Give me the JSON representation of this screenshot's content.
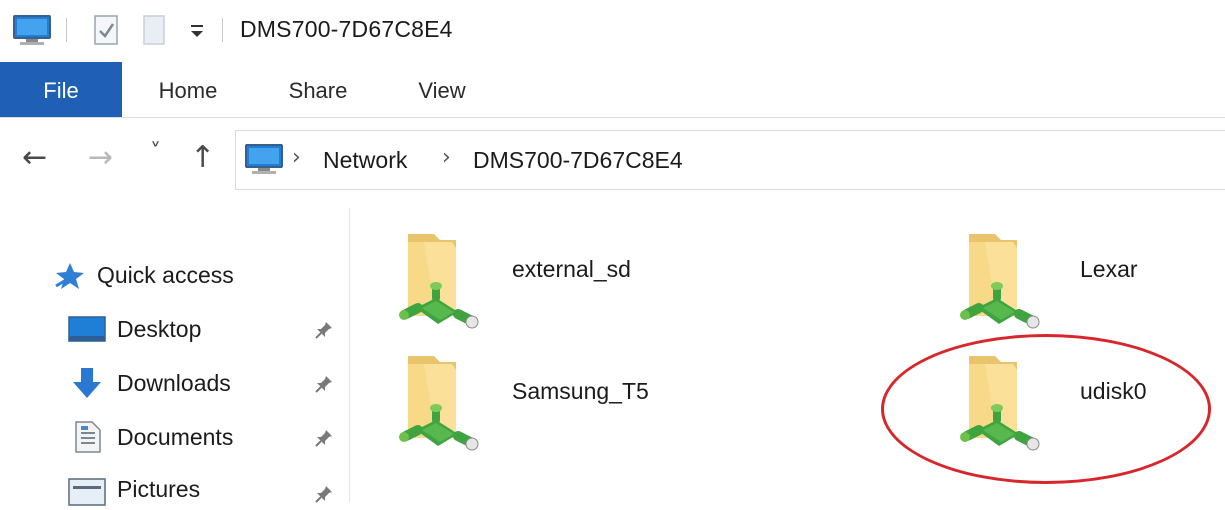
{
  "window": {
    "title": "DMS700-7D67C8E4",
    "qat_icons": [
      "computer-icon",
      "properties-icon",
      "new-folder-icon",
      "customize-qat-icon"
    ]
  },
  "ribbon": {
    "tabs": [
      {
        "label": "File",
        "active": true
      },
      {
        "label": "Home"
      },
      {
        "label": "Share"
      },
      {
        "label": "View"
      }
    ],
    "accent": "#1f5fb5"
  },
  "address_bar": {
    "crumbs": [
      "Network",
      "DMS700-7D67C8E4"
    ],
    "root_icon": "computer-icon",
    "separator": "›"
  },
  "nav_buttons": {
    "back": "←",
    "forward": "→",
    "recent": "˅",
    "up": "↑"
  },
  "nav_pane": {
    "quick_access": "Quick access",
    "items": [
      {
        "label": "Desktop",
        "icon": "desktop-icon",
        "pinned": true
      },
      {
        "label": "Downloads",
        "icon": "downloads-icon",
        "pinned": true
      },
      {
        "label": "Documents",
        "icon": "documents-icon",
        "pinned": true
      },
      {
        "label": "Pictures",
        "icon": "pictures-icon",
        "pinned": true
      }
    ]
  },
  "content": {
    "items": [
      {
        "label": "external_sd",
        "icon": "network-share-folder-icon"
      },
      {
        "label": "Lexar",
        "icon": "network-share-folder-icon"
      },
      {
        "label": "Samsung_T5",
        "icon": "network-share-folder-icon"
      },
      {
        "label": "udisk0",
        "icon": "network-share-folder-icon",
        "highlighted": true
      }
    ],
    "highlight_color": "#d9262b"
  }
}
